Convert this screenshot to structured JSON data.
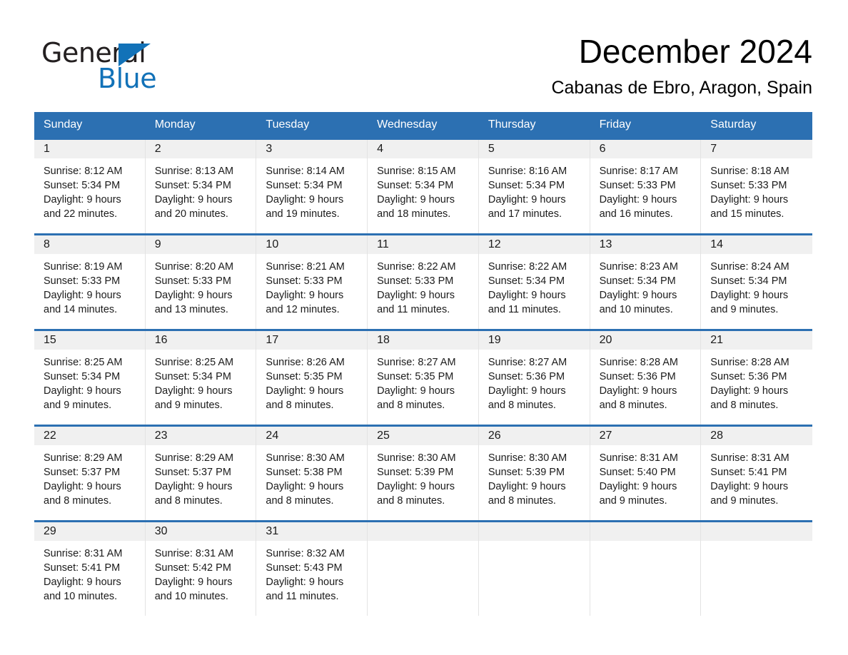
{
  "brand": {
    "name_part1": "General",
    "name_part2": "Blue",
    "triangle_color": "#1272b8"
  },
  "header": {
    "title": "December 2024",
    "subtitle": "Cabanas de Ebro, Aragon, Spain",
    "accent_color": "#2c70b2",
    "band_color": "#f0f0f0"
  },
  "weekdays": [
    "Sunday",
    "Monday",
    "Tuesday",
    "Wednesday",
    "Thursday",
    "Friday",
    "Saturday"
  ],
  "weeks": [
    [
      {
        "day": "1",
        "sunrise": "Sunrise: 8:12 AM",
        "sunset": "Sunset: 5:34 PM",
        "daylight_line1": "Daylight: 9 hours",
        "daylight_line2": "and 22 minutes."
      },
      {
        "day": "2",
        "sunrise": "Sunrise: 8:13 AM",
        "sunset": "Sunset: 5:34 PM",
        "daylight_line1": "Daylight: 9 hours",
        "daylight_line2": "and 20 minutes."
      },
      {
        "day": "3",
        "sunrise": "Sunrise: 8:14 AM",
        "sunset": "Sunset: 5:34 PM",
        "daylight_line1": "Daylight: 9 hours",
        "daylight_line2": "and 19 minutes."
      },
      {
        "day": "4",
        "sunrise": "Sunrise: 8:15 AM",
        "sunset": "Sunset: 5:34 PM",
        "daylight_line1": "Daylight: 9 hours",
        "daylight_line2": "and 18 minutes."
      },
      {
        "day": "5",
        "sunrise": "Sunrise: 8:16 AM",
        "sunset": "Sunset: 5:34 PM",
        "daylight_line1": "Daylight: 9 hours",
        "daylight_line2": "and 17 minutes."
      },
      {
        "day": "6",
        "sunrise": "Sunrise: 8:17 AM",
        "sunset": "Sunset: 5:33 PM",
        "daylight_line1": "Daylight: 9 hours",
        "daylight_line2": "and 16 minutes."
      },
      {
        "day": "7",
        "sunrise": "Sunrise: 8:18 AM",
        "sunset": "Sunset: 5:33 PM",
        "daylight_line1": "Daylight: 9 hours",
        "daylight_line2": "and 15 minutes."
      }
    ],
    [
      {
        "day": "8",
        "sunrise": "Sunrise: 8:19 AM",
        "sunset": "Sunset: 5:33 PM",
        "daylight_line1": "Daylight: 9 hours",
        "daylight_line2": "and 14 minutes."
      },
      {
        "day": "9",
        "sunrise": "Sunrise: 8:20 AM",
        "sunset": "Sunset: 5:33 PM",
        "daylight_line1": "Daylight: 9 hours",
        "daylight_line2": "and 13 minutes."
      },
      {
        "day": "10",
        "sunrise": "Sunrise: 8:21 AM",
        "sunset": "Sunset: 5:33 PM",
        "daylight_line1": "Daylight: 9 hours",
        "daylight_line2": "and 12 minutes."
      },
      {
        "day": "11",
        "sunrise": "Sunrise: 8:22 AM",
        "sunset": "Sunset: 5:33 PM",
        "daylight_line1": "Daylight: 9 hours",
        "daylight_line2": "and 11 minutes."
      },
      {
        "day": "12",
        "sunrise": "Sunrise: 8:22 AM",
        "sunset": "Sunset: 5:34 PM",
        "daylight_line1": "Daylight: 9 hours",
        "daylight_line2": "and 11 minutes."
      },
      {
        "day": "13",
        "sunrise": "Sunrise: 8:23 AM",
        "sunset": "Sunset: 5:34 PM",
        "daylight_line1": "Daylight: 9 hours",
        "daylight_line2": "and 10 minutes."
      },
      {
        "day": "14",
        "sunrise": "Sunrise: 8:24 AM",
        "sunset": "Sunset: 5:34 PM",
        "daylight_line1": "Daylight: 9 hours",
        "daylight_line2": "and 9 minutes."
      }
    ],
    [
      {
        "day": "15",
        "sunrise": "Sunrise: 8:25 AM",
        "sunset": "Sunset: 5:34 PM",
        "daylight_line1": "Daylight: 9 hours",
        "daylight_line2": "and 9 minutes."
      },
      {
        "day": "16",
        "sunrise": "Sunrise: 8:25 AM",
        "sunset": "Sunset: 5:34 PM",
        "daylight_line1": "Daylight: 9 hours",
        "daylight_line2": "and 9 minutes."
      },
      {
        "day": "17",
        "sunrise": "Sunrise: 8:26 AM",
        "sunset": "Sunset: 5:35 PM",
        "daylight_line1": "Daylight: 9 hours",
        "daylight_line2": "and 8 minutes."
      },
      {
        "day": "18",
        "sunrise": "Sunrise: 8:27 AM",
        "sunset": "Sunset: 5:35 PM",
        "daylight_line1": "Daylight: 9 hours",
        "daylight_line2": "and 8 minutes."
      },
      {
        "day": "19",
        "sunrise": "Sunrise: 8:27 AM",
        "sunset": "Sunset: 5:36 PM",
        "daylight_line1": "Daylight: 9 hours",
        "daylight_line2": "and 8 minutes."
      },
      {
        "day": "20",
        "sunrise": "Sunrise: 8:28 AM",
        "sunset": "Sunset: 5:36 PM",
        "daylight_line1": "Daylight: 9 hours",
        "daylight_line2": "and 8 minutes."
      },
      {
        "day": "21",
        "sunrise": "Sunrise: 8:28 AM",
        "sunset": "Sunset: 5:36 PM",
        "daylight_line1": "Daylight: 9 hours",
        "daylight_line2": "and 8 minutes."
      }
    ],
    [
      {
        "day": "22",
        "sunrise": "Sunrise: 8:29 AM",
        "sunset": "Sunset: 5:37 PM",
        "daylight_line1": "Daylight: 9 hours",
        "daylight_line2": "and 8 minutes."
      },
      {
        "day": "23",
        "sunrise": "Sunrise: 8:29 AM",
        "sunset": "Sunset: 5:37 PM",
        "daylight_line1": "Daylight: 9 hours",
        "daylight_line2": "and 8 minutes."
      },
      {
        "day": "24",
        "sunrise": "Sunrise: 8:30 AM",
        "sunset": "Sunset: 5:38 PM",
        "daylight_line1": "Daylight: 9 hours",
        "daylight_line2": "and 8 minutes."
      },
      {
        "day": "25",
        "sunrise": "Sunrise: 8:30 AM",
        "sunset": "Sunset: 5:39 PM",
        "daylight_line1": "Daylight: 9 hours",
        "daylight_line2": "and 8 minutes."
      },
      {
        "day": "26",
        "sunrise": "Sunrise: 8:30 AM",
        "sunset": "Sunset: 5:39 PM",
        "daylight_line1": "Daylight: 9 hours",
        "daylight_line2": "and 8 minutes."
      },
      {
        "day": "27",
        "sunrise": "Sunrise: 8:31 AM",
        "sunset": "Sunset: 5:40 PM",
        "daylight_line1": "Daylight: 9 hours",
        "daylight_line2": "and 9 minutes."
      },
      {
        "day": "28",
        "sunrise": "Sunrise: 8:31 AM",
        "sunset": "Sunset: 5:41 PM",
        "daylight_line1": "Daylight: 9 hours",
        "daylight_line2": "and 9 minutes."
      }
    ],
    [
      {
        "day": "29",
        "sunrise": "Sunrise: 8:31 AM",
        "sunset": "Sunset: 5:41 PM",
        "daylight_line1": "Daylight: 9 hours",
        "daylight_line2": "and 10 minutes."
      },
      {
        "day": "30",
        "sunrise": "Sunrise: 8:31 AM",
        "sunset": "Sunset: 5:42 PM",
        "daylight_line1": "Daylight: 9 hours",
        "daylight_line2": "and 10 minutes."
      },
      {
        "day": "31",
        "sunrise": "Sunrise: 8:32 AM",
        "sunset": "Sunset: 5:43 PM",
        "daylight_line1": "Daylight: 9 hours",
        "daylight_line2": "and 11 minutes."
      },
      {
        "day": "",
        "sunrise": "",
        "sunset": "",
        "daylight_line1": "",
        "daylight_line2": ""
      },
      {
        "day": "",
        "sunrise": "",
        "sunset": "",
        "daylight_line1": "",
        "daylight_line2": ""
      },
      {
        "day": "",
        "sunrise": "",
        "sunset": "",
        "daylight_line1": "",
        "daylight_line2": ""
      },
      {
        "day": "",
        "sunrise": "",
        "sunset": "",
        "daylight_line1": "",
        "daylight_line2": ""
      }
    ]
  ]
}
